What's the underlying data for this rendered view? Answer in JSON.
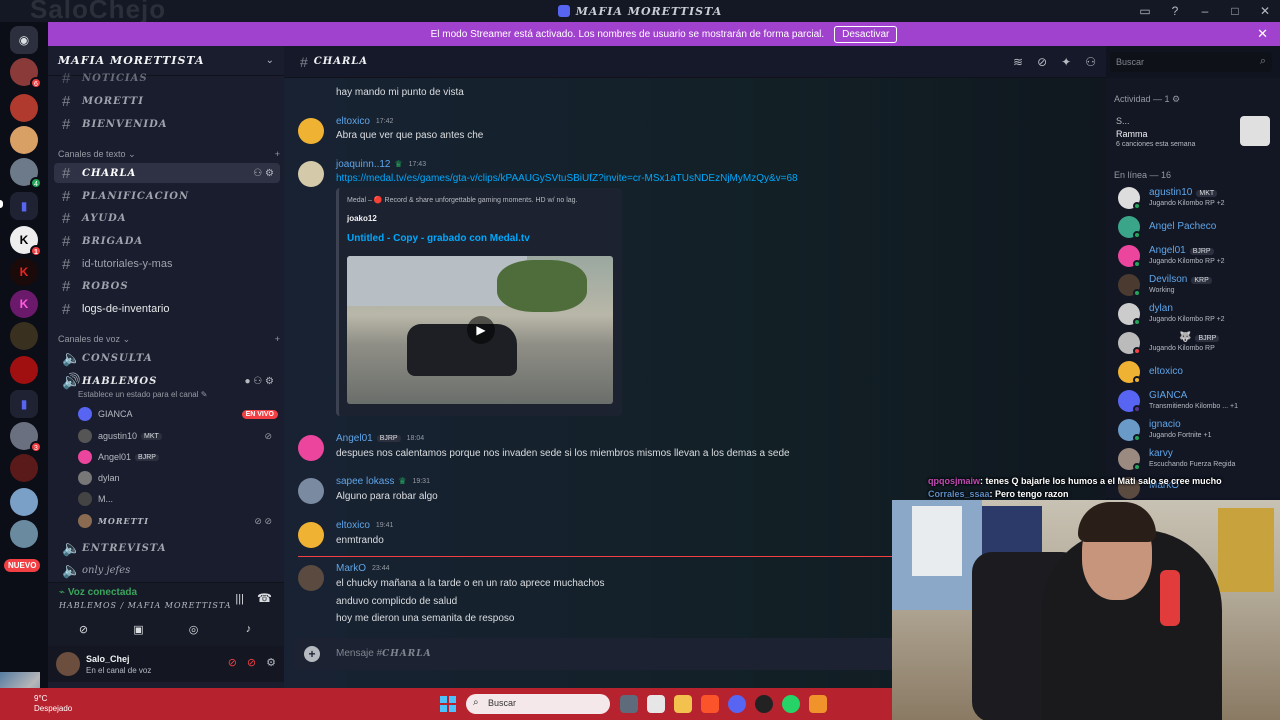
{
  "window": {
    "title": "MAFIA MORETTISTA",
    "ghost_logo": "SaloChejo"
  },
  "banner": {
    "text": "El modo Streamer está activado. Los nombres de usuario se mostrarán de forma parcial.",
    "button": "Desactivar"
  },
  "guild": {
    "name": "MAFIA MORETTISTA"
  },
  "channels_top": [
    {
      "name": "NOTICIAS"
    },
    {
      "name": "MORETTI"
    },
    {
      "name": "BIENVENIDA"
    }
  ],
  "text_category": "Canales de texto",
  "text_channels": [
    {
      "name": "CHARLA"
    },
    {
      "name": "PLANIFICACION"
    },
    {
      "name": "AYUDA"
    },
    {
      "name": "BRIGADA"
    },
    {
      "name": "id-tutoriales-y-mas"
    },
    {
      "name": "ROBOS"
    },
    {
      "name": "logs-de-inventario"
    }
  ],
  "voice_category": "Canales de voz",
  "voice_channels": {
    "consulta": "CONSULTA",
    "hablemos": "HABLEMOS",
    "hablemos_status": "Establece un estado para el canal",
    "entrevista": "ENTREVISTA",
    "jefes": "only jefes"
  },
  "voice_users": [
    {
      "name": "GIANCA",
      "tag": "",
      "live": "EN VIVO"
    },
    {
      "name": "agustin10",
      "tag": "MKT"
    },
    {
      "name": "Angel01",
      "tag": "BJRP"
    },
    {
      "name": "dylan",
      "tag": ""
    },
    {
      "name": "M...",
      "tag": ""
    },
    {
      "name": "MORETTI",
      "tag": ""
    }
  ],
  "voice_panel": {
    "status": "Voz conectada",
    "channel": "HABLEMOS / MAFIA MORETTISTA"
  },
  "user_panel": {
    "username": "Salo_Chej",
    "status": "En el canal de voz"
  },
  "servers": {
    "new_label": "NUEVO",
    "badge1": "6",
    "badge2": "4",
    "badge3": "1",
    "badge4": "3"
  },
  "chat_header": {
    "channel": "CHARLA",
    "search_placeholder": "Buscar"
  },
  "messages": [
    {
      "author": "",
      "time": "",
      "text": "hay mando mi punto de vista"
    },
    {
      "author": "eltoxico",
      "time": "17:42",
      "text": "Abra que ver que paso antes che"
    },
    {
      "author": "joaquinn..12",
      "time": "17:43",
      "text": "https://medal.tv/es/games/gta-v/clips/kPAAUGySVtuSBiUfZ?invite=cr-MSx1aTUsNDEzNjMyMzQy&v=68"
    },
    {
      "author": "Angel01",
      "tag": "BJRP",
      "time": "18:04",
      "text": "despues nos calentamos porque nos invaden sede si los miembros mismos llevan a los demas a sede"
    },
    {
      "author": "sapee lokass",
      "time": "19:31",
      "text": "Alguno para robar algo"
    },
    {
      "author": "eltoxico",
      "time": "19:41",
      "text": "enmtrando"
    },
    {
      "author": "MarkO",
      "time": "23:44",
      "lines": [
        "el chucky mañana a la tarde o en un rato aprece muchachos",
        "anduvo complicdo de salud",
        "hoy me dieron una semanita de resposo"
      ]
    }
  ],
  "embed": {
    "provider": "Medal – 🔴 Record & share unforgettable gaming moments. HD w/ no lag.",
    "author": "joako12",
    "title": "Untitled - Copy - grabado con Medal.tv"
  },
  "composer": {
    "prefix": "Mensaje #",
    "channel": "CHARLA"
  },
  "members": {
    "activity_header": "Actividad — 1",
    "activity": {
      "title": "S...",
      "name": "Ramma",
      "desc": "6 canciones esta semana"
    },
    "online_header": "En línea — 16",
    "list": [
      {
        "name": "agustin10",
        "tag": "MKT",
        "activity": "Jugando Kilombo RP +2"
      },
      {
        "name": "Angel Pacheco",
        "tag": "",
        "activity": ""
      },
      {
        "name": "Angel01",
        "tag": "BJRP",
        "activity": "Jugando Kilombo RP +2"
      },
      {
        "name": "Devilson",
        "tag": "KRP",
        "activity": "Working"
      },
      {
        "name": "dylan",
        "tag": "",
        "activity": "Jugando Kilombo RP +2"
      },
      {
        "name": "",
        "tag": "BJRP",
        "activity": "Jugando Kilombo RP"
      },
      {
        "name": "eltoxico",
        "tag": "",
        "activity": ""
      },
      {
        "name": "GIANCA",
        "tag": "",
        "activity": "Transmitiendo Kilombo ... +1"
      },
      {
        "name": "ignacio",
        "tag": "",
        "activity": "Jugando Fortnite +1"
      },
      {
        "name": "karvy",
        "tag": "",
        "activity": "Escuchando Fuerza Regida"
      },
      {
        "name": "MarkO",
        "tag": "",
        "activity": ""
      }
    ]
  },
  "stream_chat": [
    {
      "user": "qpqosjmaiw",
      "text": ": tenes Q bajarle los humos a el Mati salo se cree mucho"
    },
    {
      "user": "Corrales_ssaa",
      "text": ": Pero tengo razon"
    }
  ],
  "taskbar": {
    "temp": "9°C",
    "weather": "Despejado",
    "search": "Buscar"
  },
  "colors": {
    "accent": "#5865f2",
    "streamer_banner": "#a142cf",
    "online": "#23a55a",
    "live": "#f23f43",
    "link": "#00a8fc"
  }
}
